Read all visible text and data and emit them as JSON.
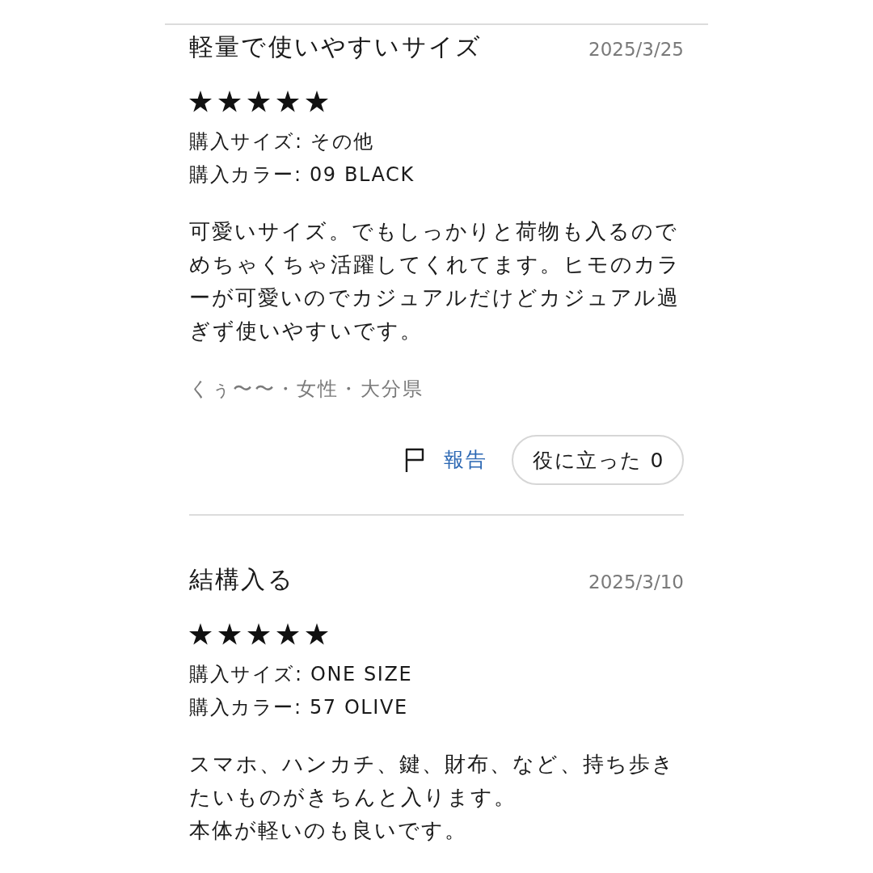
{
  "reviews": [
    {
      "title": "軽量で使いやすいサイズ",
      "date": "2025/3/25",
      "stars": 5,
      "details": [
        {
          "label": "購入サイズ:",
          "value": "その他"
        },
        {
          "label": "購入カラー:",
          "value": "09 BLACK"
        }
      ],
      "body": [
        "可愛いサイズ。でもしっかりと荷物も入るのでめちゃくちゃ活躍してくれてます。ヒモのカラーが可愛いのでカジュアルだけどカジュアル過ぎず使いやすいです。"
      ],
      "author": "くぅ〜〜・女性・大分県",
      "report_label": "報告",
      "helpful_label": "役に立った 0"
    },
    {
      "title": "結構入る",
      "date": "2025/3/10",
      "stars": 5,
      "details": [
        {
          "label": "購入サイズ:",
          "value": "ONE SIZE"
        },
        {
          "label": "購入カラー:",
          "value": "57 OLIVE"
        }
      ],
      "body": [
        "スマホ、ハンカチ、鍵、財布、など、持ち歩きたいものがきちんと入ります。",
        "本体が軽いのも良いです。"
      ]
    }
  ]
}
